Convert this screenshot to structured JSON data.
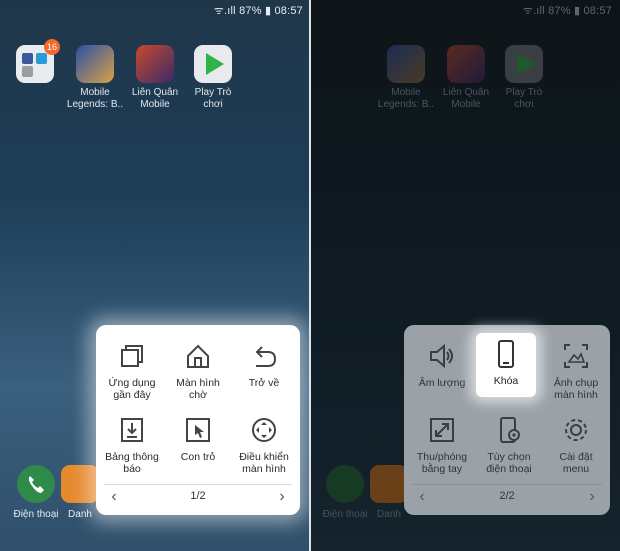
{
  "left_screen": {
    "status_text": "ᯤ.ıll 87% ▮ 08:57",
    "apps": [
      {
        "label": "",
        "badge": "16",
        "icon": "folder-icon"
      },
      {
        "label": "Mobile\nLegends: B..",
        "icon": "mobile-legends-icon"
      },
      {
        "label": "Liên Quân\nMobile",
        "icon": "lien-quan-icon"
      },
      {
        "label": "Play Trò\nchơi",
        "icon": "play-games-icon"
      }
    ],
    "dock": [
      {
        "label": "Điện thoại",
        "icon": "phone-icon"
      },
      {
        "label": "Danh",
        "icon": "contacts-icon"
      }
    ],
    "menu": {
      "items": [
        {
          "label": "Ứng dụng\ngần đây",
          "icon": "recent-apps-icon"
        },
        {
          "label": "Màn hình\nchờ",
          "icon": "home-icon"
        },
        {
          "label": "Trở về",
          "icon": "back-icon"
        },
        {
          "label": "Bảng thông\nbáo",
          "icon": "notification-panel-icon"
        },
        {
          "label": "Con trỏ",
          "icon": "cursor-icon"
        },
        {
          "label": "Điều khiển\nmàn hình",
          "icon": "screen-control-icon"
        }
      ],
      "page": "1/2",
      "prev": "‹",
      "next": "›"
    }
  },
  "right_screen": {
    "status_text": "ᯤ.ıll 87% ▮ 08:57",
    "apps": [
      {
        "label": "Mobile\nLegends: B..",
        "icon": "mobile-legends-icon"
      },
      {
        "label": "Liên Quân\nMobile",
        "icon": "lien-quan-icon"
      },
      {
        "label": "Play Trò\nchơi",
        "icon": "play-games-icon"
      }
    ],
    "dock": [
      {
        "label": "Điện thoại",
        "icon": "phone-icon"
      },
      {
        "label": "Danh",
        "icon": "contacts-icon"
      }
    ],
    "menu": {
      "items": [
        {
          "label": "Âm lượng",
          "icon": "volume-icon"
        },
        {
          "label": "Khóa",
          "icon": "lock-phone-icon"
        },
        {
          "label": "Ảnh chụp\nmàn hình",
          "icon": "screenshot-icon"
        },
        {
          "label": "Thu/phóng\nbằng tay",
          "icon": "zoom-icon"
        },
        {
          "label": "Tùy chọn\nđiện thoại",
          "icon": "phone-options-icon"
        },
        {
          "label": "Cài đặt\nmenu",
          "icon": "settings-icon"
        }
      ],
      "page": "2/2",
      "prev": "‹",
      "next": "›"
    }
  },
  "colors": {
    "menu_bg": "#ffffff",
    "dim_menu_bg": "#9aa2a8",
    "badge": "#f26a2a"
  }
}
